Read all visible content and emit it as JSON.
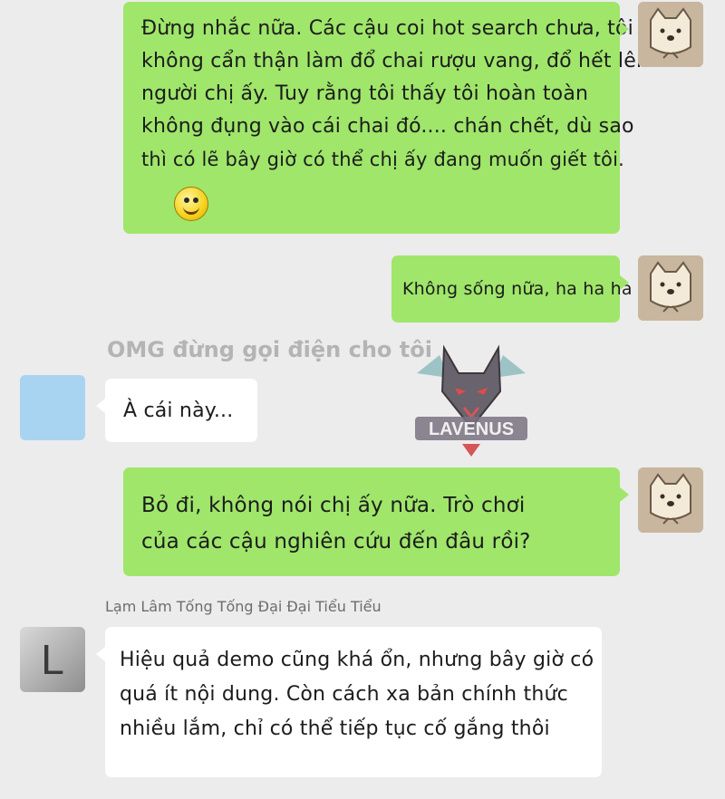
{
  "messages": [
    {
      "lines": [
        "Đừng nhắc nữa. Các cậu coi hot search chưa, tôi",
        "không cẩn thận làm đổ chai rượu vang, đổ hết lên",
        "người chị ấy. Tuy rằng tôi thấy tôi hoàn toàn",
        "không đụng vào cái chai đó.... chán chết, dù sao",
        "thì có lẽ bây giờ có thể chị ấy đang muốn giết tôi."
      ]
    },
    {
      "lines": [
        "Không sống nữa, ha ha ha"
      ]
    },
    {
      "sender": "OMG đừng gọi điện cho tôi",
      "lines": [
        "À cái này..."
      ]
    },
    {
      "lines": [
        "Bỏ đi, không nói chị ấy nữa. Trò chơi",
        "của các cậu nghiên cứu đến đâu rồi?"
      ]
    },
    {
      "sender": "Lạm Lâm Tống Tống Đại Đại Tiểu Tiểu",
      "avatar_letter": "L",
      "lines": [
        "Hiệu quả demo cũng khá ổn, nhưng bây giờ có",
        "quá ít nội dung. Còn cách xa bản chính thức",
        "nhiều lắm, chỉ có thể tiếp tục cố gắng thôi"
      ]
    }
  ],
  "watermark": {
    "text": "LAVENUS"
  },
  "icons": {
    "self_avatar": "dog-avatar-icon",
    "emoji": "smiley-emoji-icon",
    "watermark": "wolf-logo-icon"
  },
  "colors": {
    "background": "#ececec",
    "outgoing_bubble": "#9fe66a",
    "incoming_bubble": "#ffffff"
  }
}
